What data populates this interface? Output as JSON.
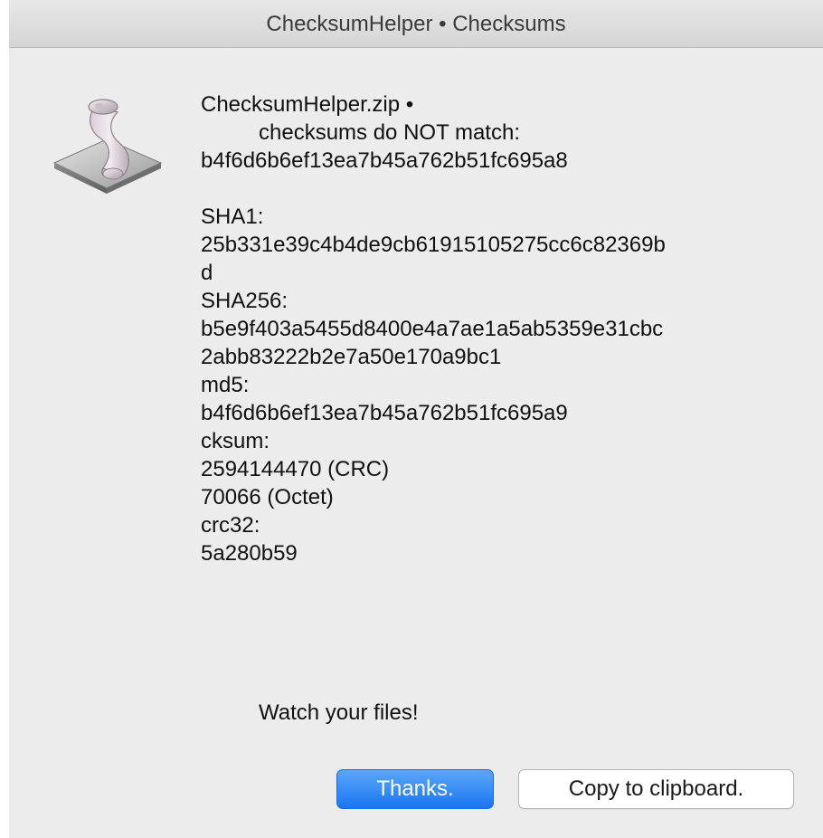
{
  "window": {
    "title": "ChecksumHelper • Checksums"
  },
  "app_icon": {
    "name": "script-scroll-icon"
  },
  "message": {
    "file_line": "ChecksumHelper.zip •",
    "status_line": "checksums do NOT match:",
    "expected_hash": "b4f6d6b6ef13ea7b45a762b51fc695a8",
    "sha1_label": "SHA1:",
    "sha1_value_line1": "25b331e39c4b4de9cb61915105275cc6c82369b",
    "sha1_value_line2": "d",
    "sha256_label": "SHA256:",
    "sha256_value_line1": "b5e9f403a5455d8400e4a7ae1a5ab5359e31cbc",
    "sha256_value_line2": "2abb83222b2e7a50e170a9bc1",
    "md5_label": "md5:",
    "md5_value": "b4f6d6b6ef13ea7b45a762b51fc695a9",
    "cksum_label": "cksum:",
    "cksum_crc": "2594144470 (CRC)",
    "cksum_octet": "70066 (Octet)",
    "crc32_label": "crc32:",
    "crc32_value": "5a280b59"
  },
  "footer_note": "Watch your files!",
  "buttons": {
    "primary_label": "Thanks.",
    "secondary_label": "Copy to clipboard."
  },
  "colors": {
    "primary_button": "#1a76f0",
    "window_background": "#ececec"
  }
}
